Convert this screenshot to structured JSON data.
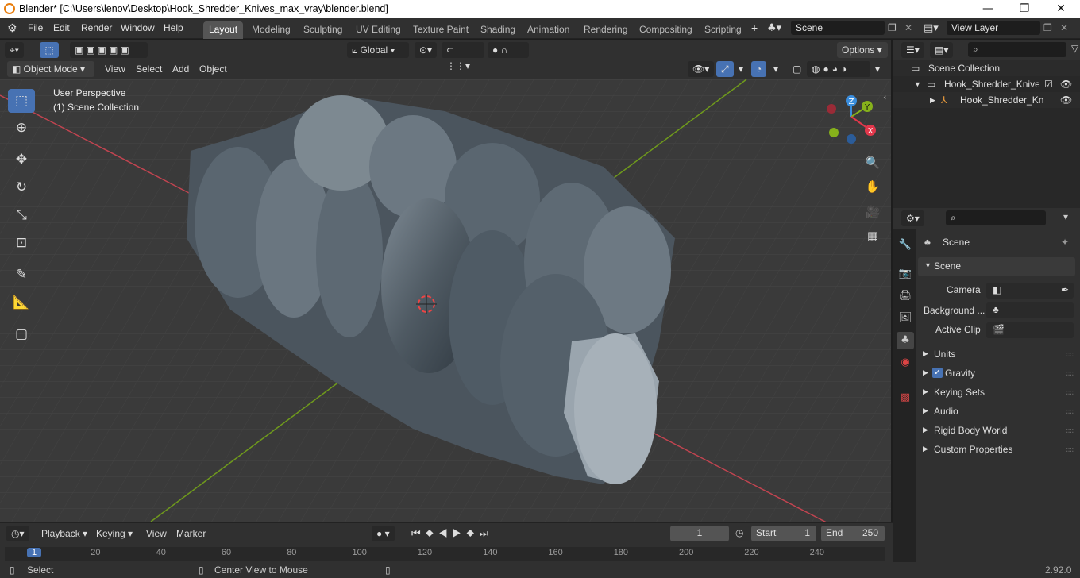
{
  "window": {
    "title": "Blender* [C:\\Users\\lenov\\Desktop\\Hook_Shredder_Knives_max_vray\\blender.blend]",
    "minimize": "—",
    "maximize": "❐",
    "close": "✕"
  },
  "menu": [
    "File",
    "Edit",
    "Render",
    "Window",
    "Help"
  ],
  "workspaces": [
    "Layout",
    "Modeling",
    "Sculpting",
    "UV Editing",
    "Texture Paint",
    "Shading",
    "Animation",
    "Rendering",
    "Compositing",
    "Scripting"
  ],
  "add_workspace": "+",
  "scene_field": "Scene",
  "view_layer_field": "View Layer",
  "viewport_header": {
    "transform_orientation": "Global",
    "options": "Options",
    "mode": "Object Mode",
    "menus": [
      "View",
      "Select",
      "Add",
      "Object"
    ]
  },
  "viewport": {
    "perspective_label": "User Perspective",
    "collection_label": "(1) Scene Collection",
    "gizmo_axes": [
      "Z",
      "Y",
      "X"
    ]
  },
  "timeline": {
    "menus": [
      "Playback",
      "Keying",
      "View",
      "Marker"
    ],
    "current_frame": "1",
    "start_label": "Start",
    "start_value": "1",
    "end_label": "End",
    "end_value": "250",
    "ruler": [
      "1",
      "20",
      "40",
      "60",
      "80",
      "100",
      "120",
      "140",
      "160",
      "180",
      "200",
      "220",
      "240"
    ]
  },
  "statusbar": {
    "select": "Select",
    "center_view": "Center View to Mouse",
    "version": "2.92.0"
  },
  "outliner": {
    "root": "Scene Collection",
    "collection": "Hook_Shredder_Knives_C",
    "object": "Hook_Shredder_Kniv"
  },
  "properties": {
    "context": "Scene",
    "panel": "Scene",
    "camera_label": "Camera",
    "background_label": "Background ...",
    "active_clip_label": "Active Clip",
    "sections": [
      "Units",
      "Gravity",
      "Keying Sets",
      "Audio",
      "Rigid Body World",
      "Custom Properties"
    ],
    "gravity_checked": true
  },
  "colors": {
    "accent": "#4772b3",
    "x_axis": "#e2374b",
    "y_axis": "#86b11b",
    "z_axis": "#3a8ddd"
  }
}
